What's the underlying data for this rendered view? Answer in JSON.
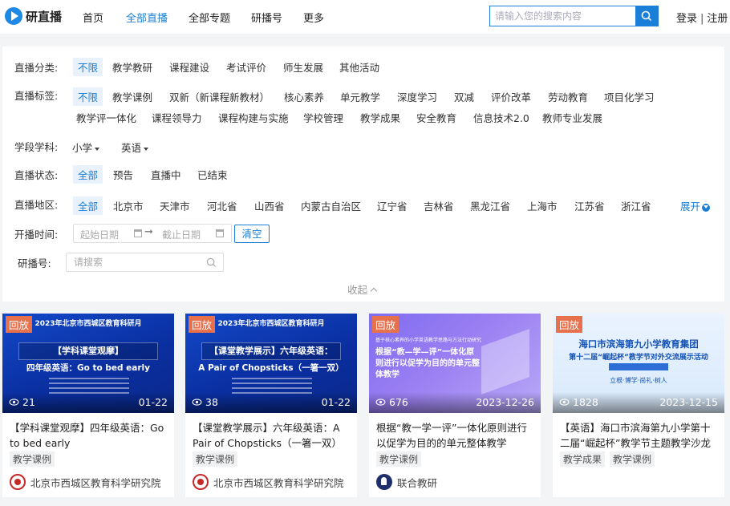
{
  "header": {
    "logo_text": "研直播",
    "nav": [
      "首页",
      "全部直播",
      "全部专题",
      "研播号",
      "更多"
    ],
    "active_nav": "全部直播",
    "search_placeholder": "请输入您的搜索内容",
    "login": "登录",
    "separator": "|",
    "register": "注册"
  },
  "filters": {
    "category": {
      "label": "直播分类:",
      "options": [
        "不限",
        "教学教研",
        "课程建设",
        "考试评价",
        "师生发展",
        "其他活动"
      ]
    },
    "tags": {
      "label": "直播标签:",
      "row1": [
        "不限",
        "教学课例",
        "双新（新课程新教材）",
        "核心素养",
        "单元教学",
        "深度学习",
        "双减",
        "评价改革",
        "劳动教育",
        "项目化学习"
      ],
      "row2": [
        "教学评一体化",
        "课程领导力",
        "课程构建与实施",
        "学校管理",
        "教学成果",
        "安全教育",
        "信息技术2.0",
        "教师专业发展"
      ]
    },
    "subject": {
      "label": "学段学科:",
      "stage": "小学",
      "subject": "英语"
    },
    "status": {
      "label": "直播状态:",
      "options": [
        "全部",
        "预告",
        "直播中",
        "已结束"
      ]
    },
    "region": {
      "label": "直播地区:",
      "options": [
        "全部",
        "北京市",
        "天津市",
        "河北省",
        "山西省",
        "内蒙古自治区",
        "辽宁省",
        "吉林省",
        "黑龙江省",
        "上海市",
        "江苏省",
        "浙江省"
      ],
      "expand": "展开"
    },
    "time": {
      "label": "开播时间:",
      "start_placeholder": "起始日期",
      "end_placeholder": "截止日期",
      "arrow": "➞",
      "clear": "清空"
    },
    "yanbo": {
      "label": "研播号:",
      "placeholder": "请搜索"
    },
    "collapse": "收起"
  },
  "cards": [
    {
      "badge": "回放",
      "thumb_top": "2023年北京市西城区教育科研月",
      "thumb_title": "【学科课堂观摩】",
      "thumb_sub": "四年级英语：Go to bed early",
      "views": "21",
      "date": "01-22",
      "title": "【学科课堂观摩】四年级英语：Go to bed early",
      "tags": [
        "教学课例"
      ],
      "author": "北京市西城区教育科学研究院"
    },
    {
      "badge": "回放",
      "thumb_top": "2023年北京市西城区教育科研月",
      "thumb_title": "【课堂教学展示】六年级英语：",
      "thumb_sub": "A Pair of Chopsticks（一箸一双）",
      "views": "38",
      "date": "01-22",
      "title": "【课堂教学展示】六年级英语：A Pair of Chopsticks（一箸一双）",
      "tags": [
        "教学课例"
      ],
      "author": "北京市西城区教育科学研究院"
    },
    {
      "badge": "回放",
      "thumb_head": "基于核心素养的小学英语教学思路与方法行动研究",
      "thumb_title": "根据“教—学—评”一体化原则进行以促学为目的的单元整体教学",
      "views": "676",
      "date": "2023-12-26",
      "title": "根据“教一学一评”一体化原则进行以促学为目的的单元整体教学",
      "tags": [
        "教学课例"
      ],
      "author": "联合教研"
    },
    {
      "badge": "回放",
      "thumb_title": "海口市滨海第九小学教育集团",
      "thumb_sub": "第十二届“崛起杯”教学节对外交流展示活动",
      "thumb_row": "立根·博学·尚礼·树人",
      "views": "1828",
      "date": "2023-12-15",
      "title": "【英语】海口市滨海第九小学第十二届“崛起杯”教学节主题教学沙龙",
      "tags": [
        "教学成果",
        "教学课例"
      ],
      "author": ""
    }
  ]
}
